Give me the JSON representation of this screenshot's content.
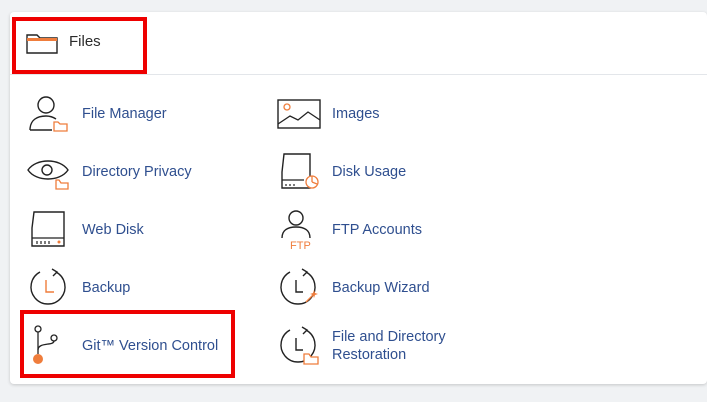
{
  "section": {
    "title": "Files"
  },
  "items": {
    "file_manager": "File Manager",
    "images": "Images",
    "directory_privacy": "Directory Privacy",
    "disk_usage": "Disk Usage",
    "web_disk": "Web Disk",
    "ftp_accounts": "FTP Accounts",
    "backup": "Backup",
    "backup_wizard": "Backup Wizard",
    "git_version_control": "Git™ Version Control",
    "file_directory_restoration": "File and Directory Restoration"
  },
  "icon_text": {
    "ftp": "FTP"
  },
  "colors": {
    "accent_orange": "#ef7d3c",
    "link_blue": "#2f4f8f",
    "highlight_red": "#ee0000"
  }
}
